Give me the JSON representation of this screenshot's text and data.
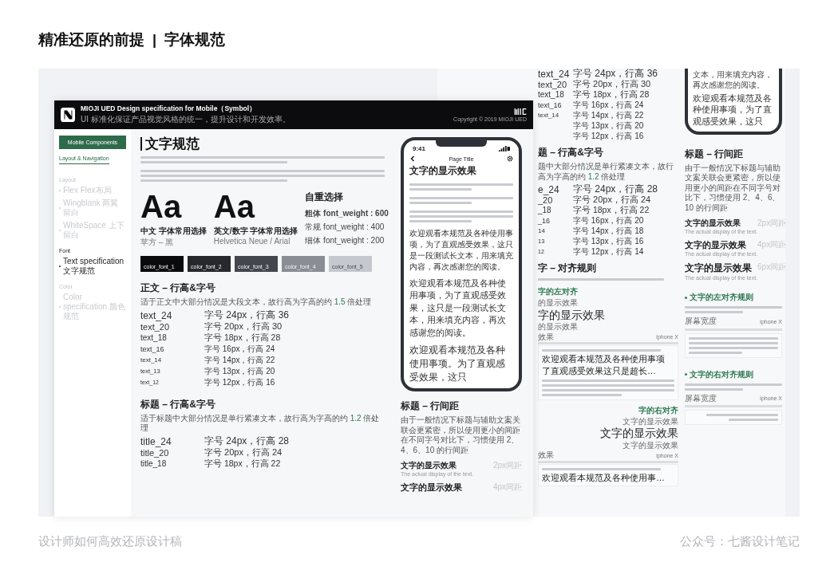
{
  "heading": {
    "title": "精准还原的前提",
    "separator": "|",
    "subtitle": "字体规范"
  },
  "back": {
    "top_rows": [
      {
        "name": "text_24",
        "spec": "字号 24px，行高 36"
      },
      {
        "name": "text_20",
        "spec": "字号 20px，行高 30"
      },
      {
        "name": "text_18",
        "spec": "字号 18px，行高 28"
      },
      {
        "name": "text_16",
        "spec": "字号 16px，行高 24"
      },
      {
        "name": "text_14",
        "spec": "字号 14px，行高 22"
      },
      {
        "spec": "字号 13px，行高 20"
      },
      {
        "spec": "字号 12px，行高 16"
      }
    ],
    "title_section": {
      "title": "题 – 行高&字号",
      "note_before": "题中大部分情况是单行紧凑文本，故行高为字高的约 ",
      "highlight": "1.2",
      "note_after": " 倍处理",
      "rows": [
        {
          "name": "e_24",
          "spec": "字号 24px，行高 28"
        },
        {
          "name": "_20",
          "spec": "字号 20px，行高 24"
        },
        {
          "name": "_18",
          "spec": "字号 18px，行高 22"
        },
        {
          "name": "_16",
          "spec": "字号 16px，行高 20"
        },
        {
          "name": "14",
          "spec": "字号 14px，行高 18"
        },
        {
          "name": "13",
          "spec": "字号 13px，行高 16"
        },
        {
          "name": "12",
          "spec": "字号 12px，行高 14"
        }
      ]
    },
    "align_section": {
      "title": "字 – 对齐规则",
      "blocks": [
        {
          "kind": "left",
          "label": "字的左对齐",
          "small_top": "的显示效果",
          "big": "字的显示效果",
          "small_bottom": "的显示效果",
          "bar_label": "效果",
          "device": "iphone X",
          "card_big": [
            "欢迎观看本规范及各种使用事项",
            "了直观感受效果这只是超长…"
          ]
        },
        {
          "kind": "right",
          "label": "字的右对齐",
          "small_top": "文字的显示效果",
          "big": "文字的显示效果",
          "small_bottom": "文字的显示效果",
          "bar_label": "效果",
          "device": "iphone X",
          "card_big": [
            "欢迎观看本规范及各种使用事…"
          ]
        }
      ]
    },
    "phone_end": [
      "文本，用来填充内容，再次感谢您的阅读。",
      "欢迎观看本规范及各种使用事项，为了直观感受效果，这只"
    ],
    "spacing_section": {
      "title": "标题 – 行间距",
      "note": "由于一般情况下标题与辅助文案关联会更紧密，所以使用更小的间距在不同字号对比下，习惯使用 2、4、6、10 的行间距",
      "items": [
        {
          "title": "文字的显示效果",
          "caption": "The actual display of the text.",
          "spacing": "2px间距"
        },
        {
          "title": "文字的显示效果",
          "caption": "The actual display of the text.",
          "spacing": "4px间距"
        },
        {
          "title": "文字的显示效果",
          "caption": "The actual display of the text.",
          "spacing": "6px间距"
        }
      ]
    },
    "rules": [
      {
        "kind": "left",
        "title": "文字的左对齐规则",
        "screen_label": "屏幕宽度",
        "device": "iphone X"
      },
      {
        "kind": "right",
        "title": "文字的右对齐规则",
        "screen_label": "屏幕宽度",
        "device": "iphone X"
      }
    ]
  },
  "front": {
    "header": {
      "title": "MIOJI UED Design specification for Mobile（Symbol）",
      "subtitle": "UI 标准化保证产品视觉风格的统一，提升设计和开发效率。",
      "copyright": "Copyright © 2019 MIOJI UED"
    },
    "sidebar": {
      "button": "Mobile Components",
      "tab": {
        "label": "Layout & Navigation",
        "selected": true
      },
      "sections": [
        {
          "label": "Layout",
          "items": [
            {
              "label": "Flex Flex布局",
              "selected": false
            },
            {
              "label": "Wingblank 两翼留白",
              "selected": false
            },
            {
              "label": "WhiteSpace 上下留白",
              "selected": false
            }
          ]
        },
        {
          "label": "Font",
          "items": [
            {
              "label": "Text specification 文字规范",
              "selected": true
            }
          ]
        },
        {
          "label": "Color",
          "items": [
            {
              "label": "Color specification 颜色规范",
              "selected": false
            }
          ]
        }
      ]
    },
    "main": {
      "title": "文字规范",
      "samples": [
        {
          "glyph": "Aa",
          "caption": "中文 字体常用选择",
          "font": "苹方 – 黑"
        },
        {
          "glyph": "Aa",
          "caption": "英文/数字 字体常用选择",
          "font": "Helvetica Neue / Arial"
        }
      ],
      "weights": {
        "title": "自重选择",
        "items": [
          {
            "kind": "bold",
            "label": "粗体 font_weight : 600"
          },
          {
            "kind": "regular",
            "label": "常规 font_weight : 400"
          },
          {
            "kind": "light",
            "label": "细体 font_weight : 200"
          }
        ]
      },
      "swatches": [
        {
          "label": "color_font_1",
          "color": "#0b0b0d"
        },
        {
          "label": "color_font_2",
          "color": "#26282c"
        },
        {
          "label": "color_font_3",
          "color": "#43464d"
        },
        {
          "label": "color_font_4",
          "color": "#8a8d94"
        },
        {
          "label": "color_font_5",
          "color": "#c5c8ce"
        }
      ],
      "body_section": {
        "title": "正文 – 行高&字号",
        "note_before": "适于正文中大部分情况是大段文本，故行高为字高的约 ",
        "highlight": "1.5",
        "note_after": " 倍处理",
        "rows": [
          {
            "name": "text_24",
            "spec": "字号 24px，行高 36"
          },
          {
            "name": "text_20",
            "spec": "字号 20px，行高 30"
          },
          {
            "name": "text_18",
            "spec": "字号 18px，行高 28"
          },
          {
            "name": "text_16",
            "spec": "字号 16px，行高 24"
          },
          {
            "name": "text_14",
            "spec": "字号 14px，行高 22"
          },
          {
            "name": "text_13",
            "spec": "字号 13px，行高 20"
          },
          {
            "name": "text_12",
            "spec": "字号 12px，行高 16"
          }
        ]
      },
      "title_section": {
        "title": "标题 – 行高&字号",
        "note_before": "适于标题中大部分情况是单行紧凑文本，故行高为字高的约 ",
        "highlight": "1.2",
        "note_after": " 倍处理",
        "rows": [
          {
            "name": "title_24",
            "spec": "字号 24px，行高 28"
          },
          {
            "name": "title_20",
            "spec": "字号 20px，行高 24"
          },
          {
            "name": "title_18",
            "spec": "字号 18px，行高 22"
          }
        ]
      }
    },
    "phone": {
      "time": "9:41",
      "title": "Page Title",
      "heading": "文字的显示效果",
      "paragraphs": [
        "欢迎观看本规范及各种使用事项，为了直观感受效果，这只是一段测试长文本，用来填充内容，再次感谢您的阅读。",
        "欢迎观看本规范及各种使用事项，为了直观感受效果，这只是一段测试长文本，用来填充内容，再次感谢您的阅读。",
        "欢迎观看本规范及各种使用事项。为了直观感受效果，这只"
      ]
    },
    "spacing_section": {
      "title": "标题 – 行间距",
      "note": "由于一般情况下标题与辅助文案关联会更紧密，所以使用更小的间距在不同字号对比下，习惯使用 2、4、6、10 的行间距",
      "items": [
        {
          "title": "文字的显示效果",
          "caption": "The actual display of the text.",
          "spacing": "2px间距"
        },
        {
          "title": "文字的显示效果",
          "spacing": "4px间距"
        }
      ]
    }
  },
  "footer": {
    "left": "设计师如何高效还原设计稿",
    "right": "公众号：七酱设计笔记"
  }
}
